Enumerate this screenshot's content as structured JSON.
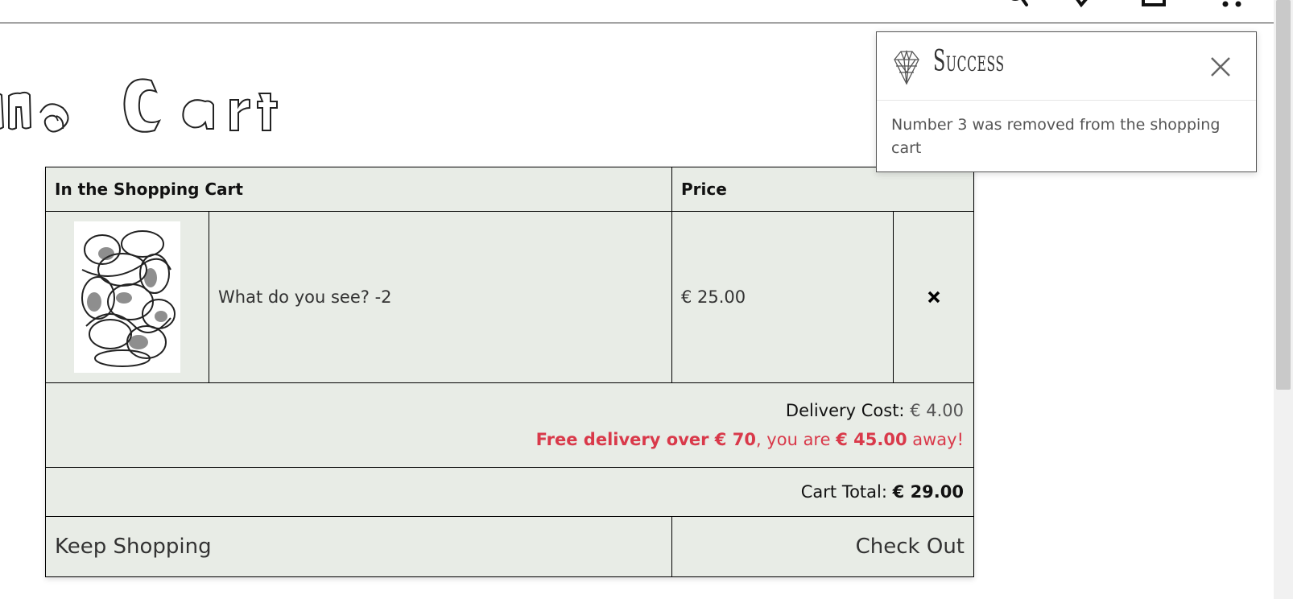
{
  "page_title": "ing Cart",
  "cart": {
    "header": {
      "item_col": "In the Shopping Cart",
      "price_col": "Price"
    },
    "items": [
      {
        "name": "What do you see? -2",
        "price": "€ 25.00",
        "remove_icon": "×"
      }
    ],
    "delivery": {
      "label": "Delivery Cost:",
      "value": "€ 4.00",
      "free_prefix": "Free delivery over € 70",
      "free_middle": ", you are ",
      "remaining": "€ 45.00",
      "free_suffix": " away!"
    },
    "total": {
      "label": "Cart Total:",
      "value": "€ 29.00"
    },
    "actions": {
      "keep_shopping": "Keep Shopping",
      "checkout": "Check Out"
    }
  },
  "toast": {
    "title": "Success",
    "message": "Number 3 was removed from the shopping cart"
  },
  "nav_icons": [
    "search-icon",
    "wishlist-icon",
    "account-icon",
    "cart-icon"
  ],
  "colors": {
    "table_bg": "#e8ece6",
    "notice_red": "#d9394a",
    "border": "#000000"
  }
}
